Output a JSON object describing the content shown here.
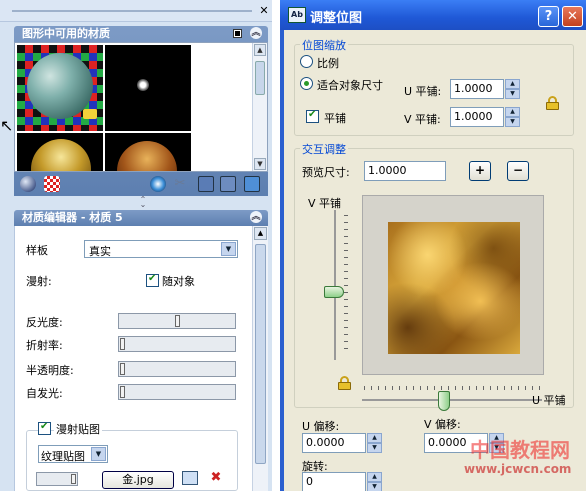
{
  "materials_panel": {
    "title": "图形中可用的材质"
  },
  "editor_panel": {
    "title": "材质编辑器 - 材质 5",
    "template_label": "样板",
    "template_value": "真实",
    "diffuse_label": "漫射:",
    "by_object_label": "随对象",
    "reflectivity_label": "反光度:",
    "reflectivity_level": 0.5,
    "refraction_label": "折射率:",
    "refraction_level": 0.0,
    "translucency_label": "半透明度:",
    "translucency_level": 0.0,
    "self_illum_label": "自发光:",
    "self_illum_level": 0.0,
    "diffuse_map_label": "漫射贴图",
    "map_type_value": "纹理贴图",
    "map_file_button": "金.jpg"
  },
  "dialog": {
    "title": "调整位图",
    "help_label": "?",
    "close_label": "✕",
    "scaling": {
      "group_title": "位图缩放",
      "option_scale": "比例",
      "option_fit": "适合对象尺寸",
      "u_tile_label": "U 平铺:",
      "u_tile_value": "1.0000",
      "v_tile_label": "V 平铺:",
      "v_tile_value": "1.0000",
      "tile_check_label": "平铺"
    },
    "interactive": {
      "group_title": "交互调整",
      "preview_size_label": "预览尺寸:",
      "preview_size_value": "1.0000",
      "plus_label": "+",
      "minus_label": "−",
      "v_tile_axis_label": "V 平铺",
      "u_tile_axis_label": "U 平铺"
    },
    "offset": {
      "u_offset_label": "U 偏移:",
      "u_offset_value": "0.0000",
      "v_offset_label": "V 偏移:",
      "v_offset_value": "0.0000",
      "rotation_label": "旋转:",
      "rotation_value": "0"
    }
  },
  "watermark": {
    "text": "中国教程网",
    "url": "www.jcwcn.com"
  },
  "colors": {
    "dialog_title_blue": "#1f58d6",
    "palette_bg": "#d6e3f2",
    "dialog_bg": "#ece9d8",
    "group_title_blue": "#0046d5"
  }
}
